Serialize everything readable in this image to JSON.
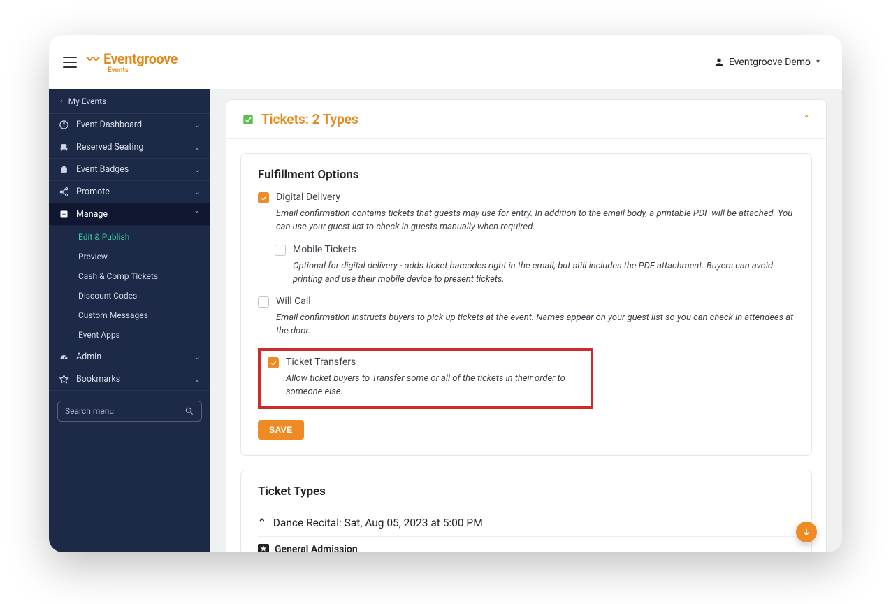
{
  "brand": {
    "name": "Eventgroove",
    "sub": "Events"
  },
  "user_menu": {
    "label": "Eventgroove Demo"
  },
  "sidebar": {
    "back_label": "My Events",
    "items": [
      {
        "label": "Event Dashboard"
      },
      {
        "label": "Reserved Seating"
      },
      {
        "label": "Event Badges"
      },
      {
        "label": "Promote"
      },
      {
        "label": "Manage"
      },
      {
        "label": "Admin"
      },
      {
        "label": "Bookmarks"
      }
    ],
    "manage_sub": [
      "Edit & Publish",
      "Preview",
      "Cash & Comp Tickets",
      "Discount Codes",
      "Custom Messages",
      "Event Apps"
    ],
    "search_placeholder": "Search menu"
  },
  "tickets_card": {
    "title": "Tickets: 2 Types",
    "fulfillment": {
      "heading": "Fulfillment Options",
      "digital": {
        "label": "Digital Delivery",
        "desc": "Email confirmation contains tickets that guests may use for entry. In addition to the email body, a printable PDF will be attached. You can use your guest list to check in guests manually when required.",
        "checked": true
      },
      "mobile": {
        "label": "Mobile Tickets",
        "desc": "Optional for digital delivery - adds ticket barcodes right in the email, but still includes the PDF attachment. Buyers can avoid printing and use their mobile device to present tickets.",
        "checked": false
      },
      "willcall": {
        "label": "Will Call",
        "desc": "Email confirmation instructs buyers to pick up tickets at the event. Names appear on your guest list so you can check in attendees at the door.",
        "checked": false
      },
      "transfers": {
        "label": "Ticket Transfers",
        "desc": "Allow ticket buyers to Transfer some or all of the tickets in their order to someone else.",
        "checked": true
      },
      "save_label": "SAVE"
    },
    "ticket_types": {
      "heading": "Ticket Types",
      "event_name": "Dance Recital:",
      "event_time": "Sat, Aug 05, 2023 at 5:00 PM",
      "ga_label": "General Admission"
    }
  }
}
